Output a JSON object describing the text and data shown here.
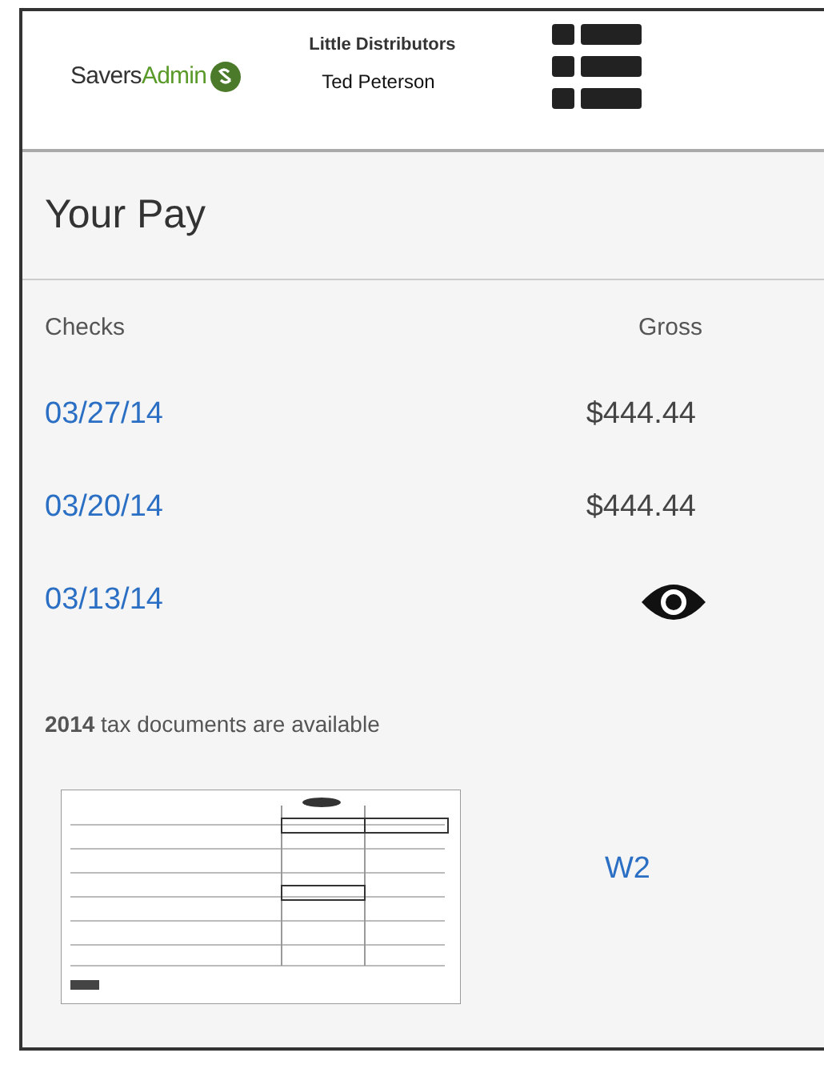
{
  "header": {
    "logo_parts": [
      "Savers",
      "Admin"
    ],
    "company": "Little Distributors",
    "user": "Ted Peterson"
  },
  "title": "Your Pay",
  "columns": [
    "Checks",
    "Gross"
  ],
  "checks": [
    {
      "date": "03/27/14",
      "kind": "amount",
      "gross": "$444.44"
    },
    {
      "date": "03/20/14",
      "kind": "amount",
      "gross": "$444.44"
    },
    {
      "date": "03/13/14",
      "kind": "hidden"
    }
  ],
  "tax_note": "**2014** tax documents are available",
  "documents": [
    {
      "kind": "picture",
      "link": "W2"
    }
  ]
}
